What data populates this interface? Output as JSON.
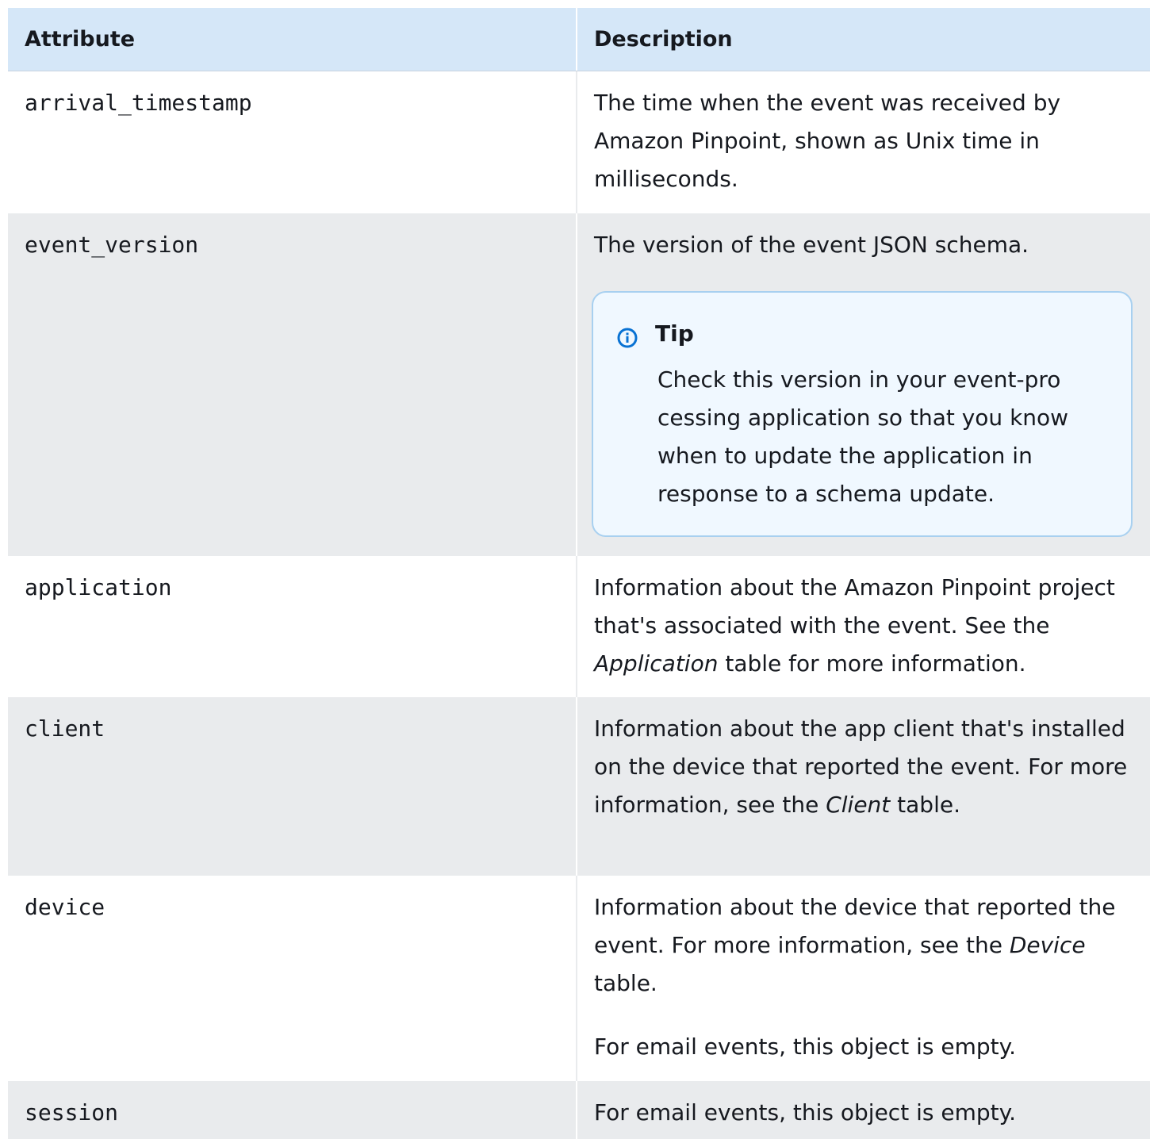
{
  "header": {
    "attribute_label": "Attribute",
    "description_label": "Description"
  },
  "rows": [
    {
      "attribute": "arrival_timestamp",
      "description": "The time when the event was received by Amazon Pinpoint, shown as Unix time in milliseconds."
    },
    {
      "attribute": "event_version",
      "description": "The version of the event JSON schema.",
      "tip": {
        "title": "Tip",
        "text": "Check this version in your event-pro cessing application so that you know when to update the application in response to a schema update."
      }
    },
    {
      "attribute": "application",
      "description_pre": "Information about the Amazon Pinpoint project that's associated with the event. See the ",
      "description_em": "Application",
      "description_post": " table for more information."
    },
    {
      "attribute": "client",
      "description_pre": "Information about the app client that's installed on the device that reported the event. For more information, see the ",
      "description_em": "Client",
      "description_post": " table."
    },
    {
      "attribute": "device",
      "description_pre": "Information about the device that reported the event. For more information, see the ",
      "description_em": "Device",
      "description_post": " table.",
      "description_extra": "For email events, this object is empty."
    },
    {
      "attribute": "session",
      "description": "For email events, this object is empty."
    }
  ],
  "colors": {
    "header_bg": "#d5e7f8",
    "row_alt_bg": "#e9ebed",
    "tip_bg": "#f0f8ff",
    "tip_border": "#a8d0f0",
    "info_icon": "#0972d3"
  },
  "icons": {
    "tip_icon": "info-circle-icon"
  }
}
